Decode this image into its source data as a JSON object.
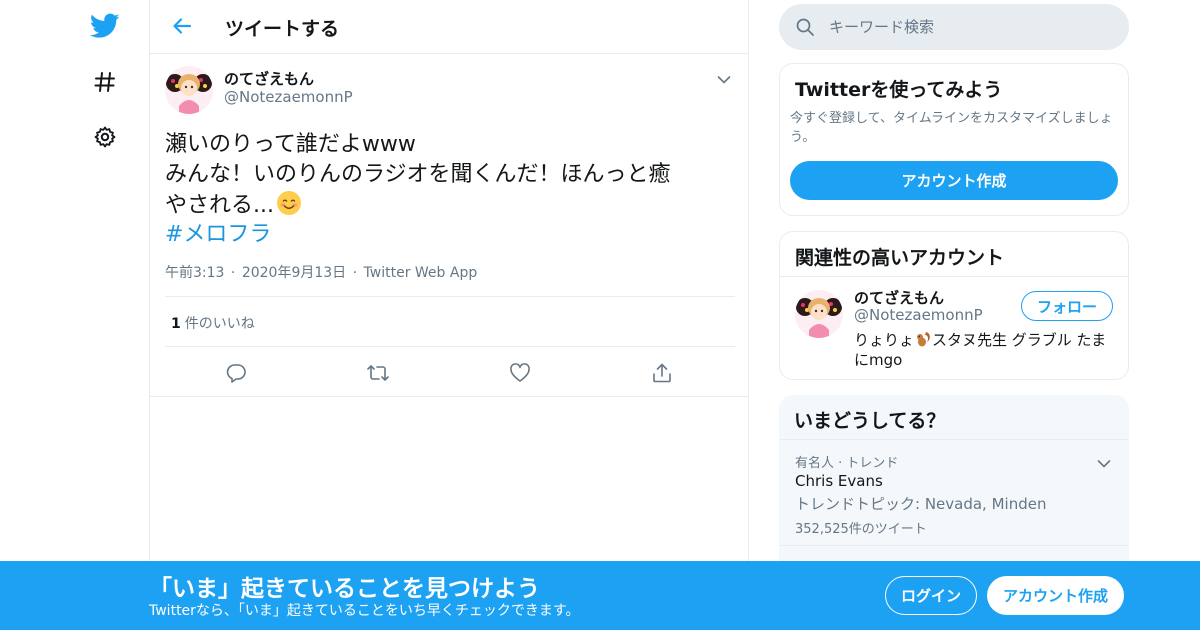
{
  "colors": {
    "accent": "#1da1f2",
    "hashtag": "#1b95e0",
    "text_primary": "#14171a",
    "text_secondary": "#657786",
    "border": "#e6ecf0",
    "search_bg": "#e6ecf0"
  },
  "left_nav": {
    "items": [
      {
        "icon": "twitter-bird-icon"
      },
      {
        "icon": "hashtag-icon"
      },
      {
        "icon": "gear-icon"
      }
    ]
  },
  "header": {
    "back_icon": "arrow-left-icon",
    "title": "ツイートする"
  },
  "tweet": {
    "author_name": "のてざえもん",
    "author_handle": "@NotezaemonnP",
    "text_lines": [
      "瀬いのりって誰だよwww",
      "みんな！いのりんのラジオを聞くんだ！ほんっと癒",
      "やされる..."
    ],
    "emoji": "smiling-face-emoji",
    "hashtag": "#メロフラ",
    "time": "午前3:13",
    "date": "2020年9月13日",
    "source": "Twitter Web App",
    "separator": "·",
    "like_count": "1",
    "like_label": "件のいいね",
    "actions": [
      {
        "icon": "reply-icon"
      },
      {
        "icon": "retweet-icon"
      },
      {
        "icon": "heart-icon"
      },
      {
        "icon": "share-icon"
      }
    ]
  },
  "search": {
    "placeholder": "キーワード検索"
  },
  "signup_card": {
    "title": "Twitterを使ってみよう",
    "description": "今すぐ登録して、タイムラインをカスタマイズしましょう。",
    "button": "アカウント作成"
  },
  "related_card": {
    "title": "関連性の高いアカウント",
    "account": {
      "name": "のてざえもん",
      "handle": "@NotezaemonnP",
      "follow_label": "フォロー",
      "bio_line1_a": "りょりょ",
      "bio_line1_b": "スタヌ先生 グラブル たま",
      "bio_emoji": "squirrel-emoji",
      "bio_line2": "にmgo"
    }
  },
  "trends_card": {
    "title": "いまどうしてる？",
    "trends": [
      {
        "category": "有名人 · トレンド",
        "name": "Chris Evans",
        "topic": "トレンドトピック: Nevada, Minden",
        "count": "352,525件のツイート"
      }
    ]
  },
  "banner": {
    "title": "「いま」起きていることを見つけよう",
    "subtitle": "Twitterなら、「いま」起きていることをいち早くチェックできます。",
    "login": "ログイン",
    "signup": "アカウント作成"
  }
}
